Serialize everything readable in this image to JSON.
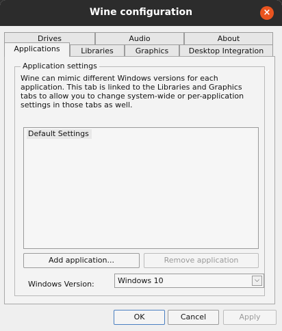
{
  "window": {
    "title": "Wine configuration",
    "close_glyph": "×"
  },
  "tabs": {
    "row1": [
      "Drives",
      "Audio",
      "About"
    ],
    "row2": [
      "Applications",
      "Libraries",
      "Graphics",
      "Desktop Integration"
    ],
    "active": "Applications"
  },
  "app_settings": {
    "group_title": "Application settings",
    "description": "Wine can mimic different Windows versions for each application. This tab is linked to the Libraries and Graphics tabs to allow you to change system-wide or per-application settings in those tabs as well.",
    "list_items": [
      "Default Settings"
    ],
    "add_button": "Add application...",
    "remove_button": "Remove application",
    "version_label": "Windows Version:",
    "version_value": "Windows 10",
    "dropdown_icon": "chevron-down-icon"
  },
  "footer": {
    "ok": "OK",
    "cancel": "Cancel",
    "apply": "Apply"
  },
  "colors": {
    "titlebar": "#2c2c2c",
    "close_button": "#e9541f",
    "window_bg": "#efefef"
  }
}
